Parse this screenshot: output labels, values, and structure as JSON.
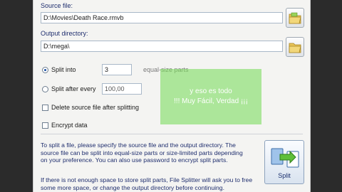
{
  "source": {
    "label": "Source file:",
    "value": "D:\\Movies\\Death Race.rmvb"
  },
  "output": {
    "label": "Output directory:",
    "value": "D:\\mega\\"
  },
  "options": {
    "split_into_label": "Split into",
    "split_into_value": "3",
    "split_into_suffix": "equal-size parts",
    "split_after_label": "Split after every",
    "split_after_value": "100,00",
    "delete_source_label": "Delete source file after splitting",
    "encrypt_label": "Encrypt data"
  },
  "info": {
    "para1_line1": "To split a file, please specify the source file and the output directory. The",
    "para1_line2": "source file can be split into equal-size parts or size-limited parts depending",
    "para1_line3": "on your preference. You can also use password to encrypt split parts.",
    "para2_line1": "If there is not enough space to store split parts, File Splitter will ask you to free",
    "para2_line2": "some more space, or change the output directory before continuing."
  },
  "split_button": {
    "label": "Split"
  },
  "overlay": {
    "line1": "y eso es todo",
    "line2": "!!! Muy Fácil, Verdad ¡¡¡"
  }
}
